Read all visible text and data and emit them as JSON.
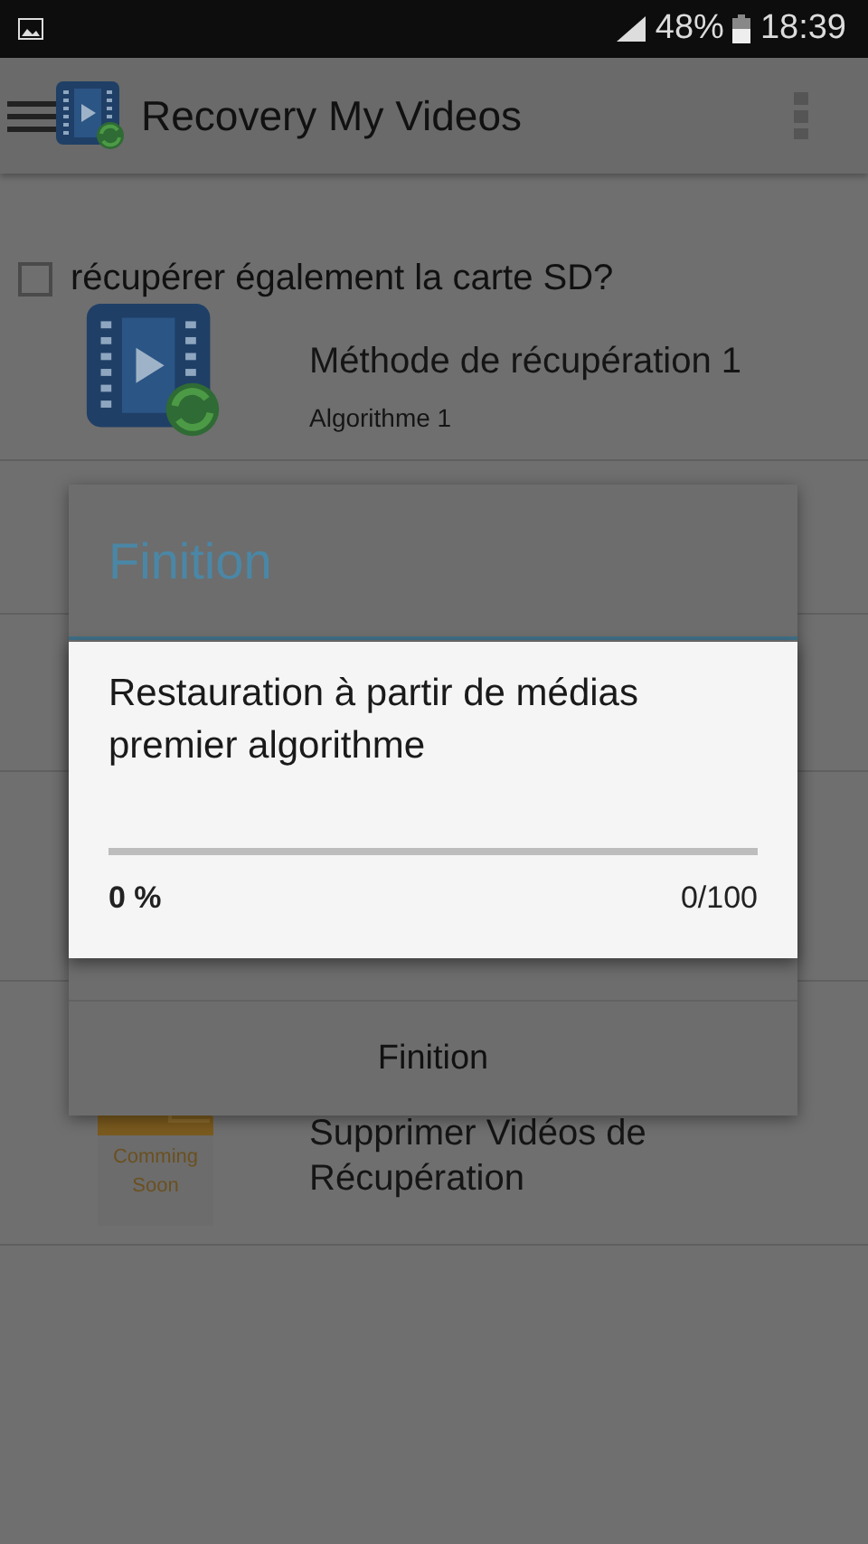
{
  "status_bar": {
    "battery": "48%",
    "time": "18:39"
  },
  "app_bar": {
    "title": "Recovery My Videos"
  },
  "sd_option": {
    "label": "récupérer également la carte SD?",
    "checked": false
  },
  "methods": [
    {
      "kind": "video",
      "title": "Méthode de récupération 1",
      "subtitle": "Algorithme 1"
    },
    {
      "kind": "coming_soon",
      "title": "Supprimer Vidéos de Récupération",
      "badge": "Comming Soon"
    }
  ],
  "dialog": {
    "title": "Finition",
    "button": "Finition"
  },
  "progress_dialog": {
    "message": "Restauration à partir de médias premier algorithme",
    "level": 0,
    "percent": "0 %",
    "count": "0/100"
  }
}
